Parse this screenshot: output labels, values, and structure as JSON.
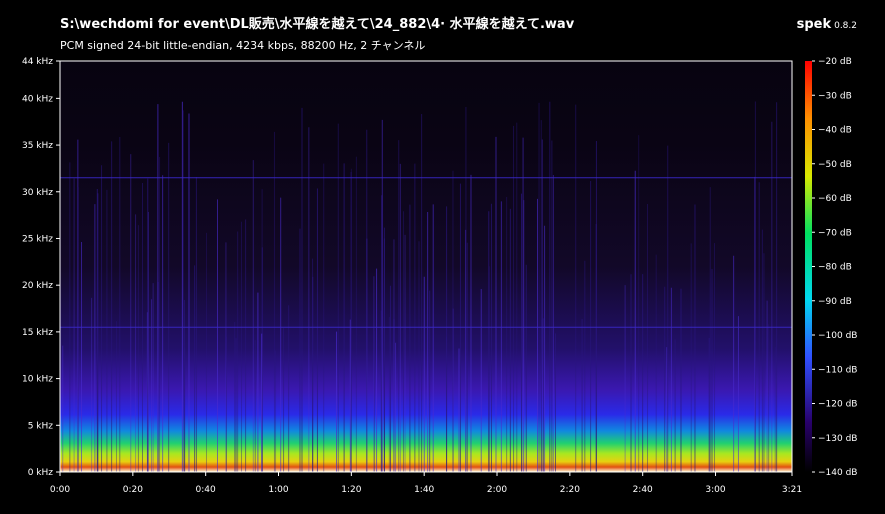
{
  "header": {
    "file_path": "S:\\wechdomi for event\\DL販売\\水平線を越えて\\24_882\\4· 水平線を越えて.wav",
    "audio_info": "PCM signed 24-bit little-endian, 4234 kbps, 88200 Hz, 2 チャンネル",
    "app_name": "spek",
    "app_version": "0.8.2"
  },
  "chart_data": {
    "type": "heatmap",
    "title": "",
    "y_axis": {
      "unit": "kHz",
      "ylim": [
        0,
        44
      ],
      "tick_labels": [
        "0 kHz",
        "5 kHz",
        "10 kHz",
        "15 kHz",
        "20 kHz",
        "25 kHz",
        "30 kHz",
        "35 kHz",
        "40 kHz",
        "44 kHz"
      ],
      "tick_values": [
        0,
        5,
        10,
        15,
        20,
        25,
        30,
        35,
        40,
        44
      ]
    },
    "x_axis": {
      "unit": "time",
      "xlim_seconds": [
        0,
        201
      ],
      "tick_labels": [
        "0:00",
        "0:20",
        "0:40",
        "1:00",
        "1:20",
        "1:40",
        "2:00",
        "2:20",
        "2:40",
        "3:00",
        "3:21"
      ],
      "tick_values_seconds": [
        0,
        20,
        40,
        60,
        80,
        100,
        120,
        140,
        160,
        180,
        201
      ]
    },
    "color_scale": {
      "unit": "dB",
      "range": [
        -140,
        -20
      ],
      "tick_labels": [
        "−20 dB",
        "−30 dB",
        "−40 dB",
        "−50 dB",
        "−60 dB",
        "−70 dB",
        "−80 dB",
        "−90 dB",
        "−100 dB",
        "−110 dB",
        "−120 dB",
        "−130 dB",
        "−140 dB"
      ],
      "tick_values": [
        -20,
        -30,
        -40,
        -50,
        -60,
        -70,
        -80,
        -90,
        -100,
        -110,
        -120,
        -130,
        -140
      ]
    },
    "notable_lines_khz": [
      15.5,
      31.5
    ]
  }
}
